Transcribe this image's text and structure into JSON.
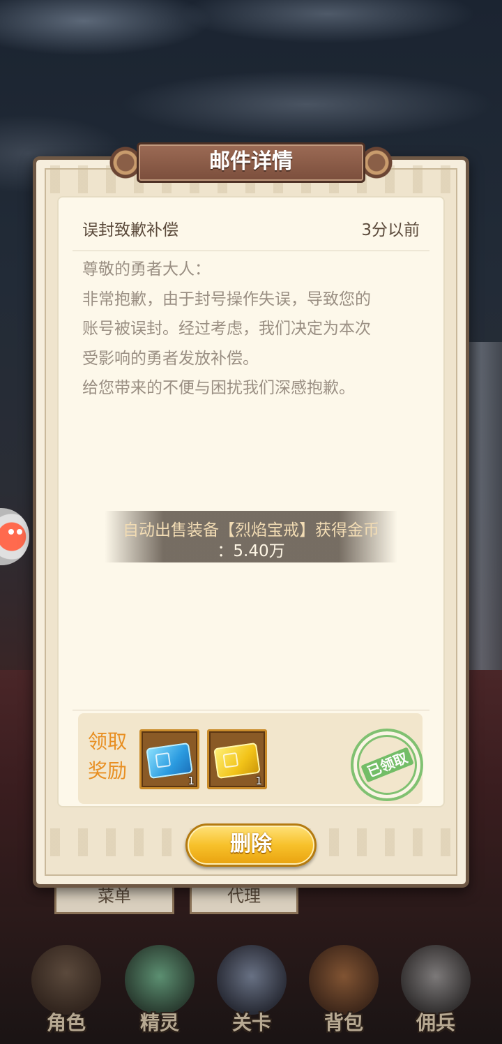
{
  "dialog": {
    "title": "邮件详情",
    "mail_title": "误封致歉补偿",
    "time": "3分以前",
    "body": [
      "尊敬的勇者大人：",
      "非常抱歉，由于封号操作失误，导致您的",
      "账号被误封。经过考虑，我们决定为本次",
      "受影响的勇者发放补偿。",
      "给您带来的不便与困扰我们深感抱歉。"
    ],
    "rewards_label": "领取奖励",
    "rewards": [
      {
        "icon": "blue-ticket-icon",
        "count": "1",
        "color": "#2b9be0"
      },
      {
        "icon": "gold-ticket-icon",
        "count": "1",
        "color": "#f2c319"
      }
    ],
    "stamp": "已领取",
    "delete_label": "删除"
  },
  "toast": {
    "line1": "自动出售装备【烈焰宝戒】获得金币",
    "line2": "：5.40万"
  },
  "background_tabs": [
    "菜单",
    "代理"
  ],
  "bottom_nav": [
    {
      "label": "角色",
      "icon": "character-icon"
    },
    {
      "label": "精灵",
      "icon": "spirit-icon"
    },
    {
      "label": "关卡",
      "icon": "stage-icon"
    },
    {
      "label": "背包",
      "icon": "backpack-icon"
    },
    {
      "label": "佣兵",
      "icon": "mercenary-icon"
    }
  ],
  "colors": {
    "accent_orange": "#e88f22",
    "button_gold": "#f7c12b",
    "stamp_green": "#6dbb62",
    "panel_brown": "#6e5845"
  }
}
